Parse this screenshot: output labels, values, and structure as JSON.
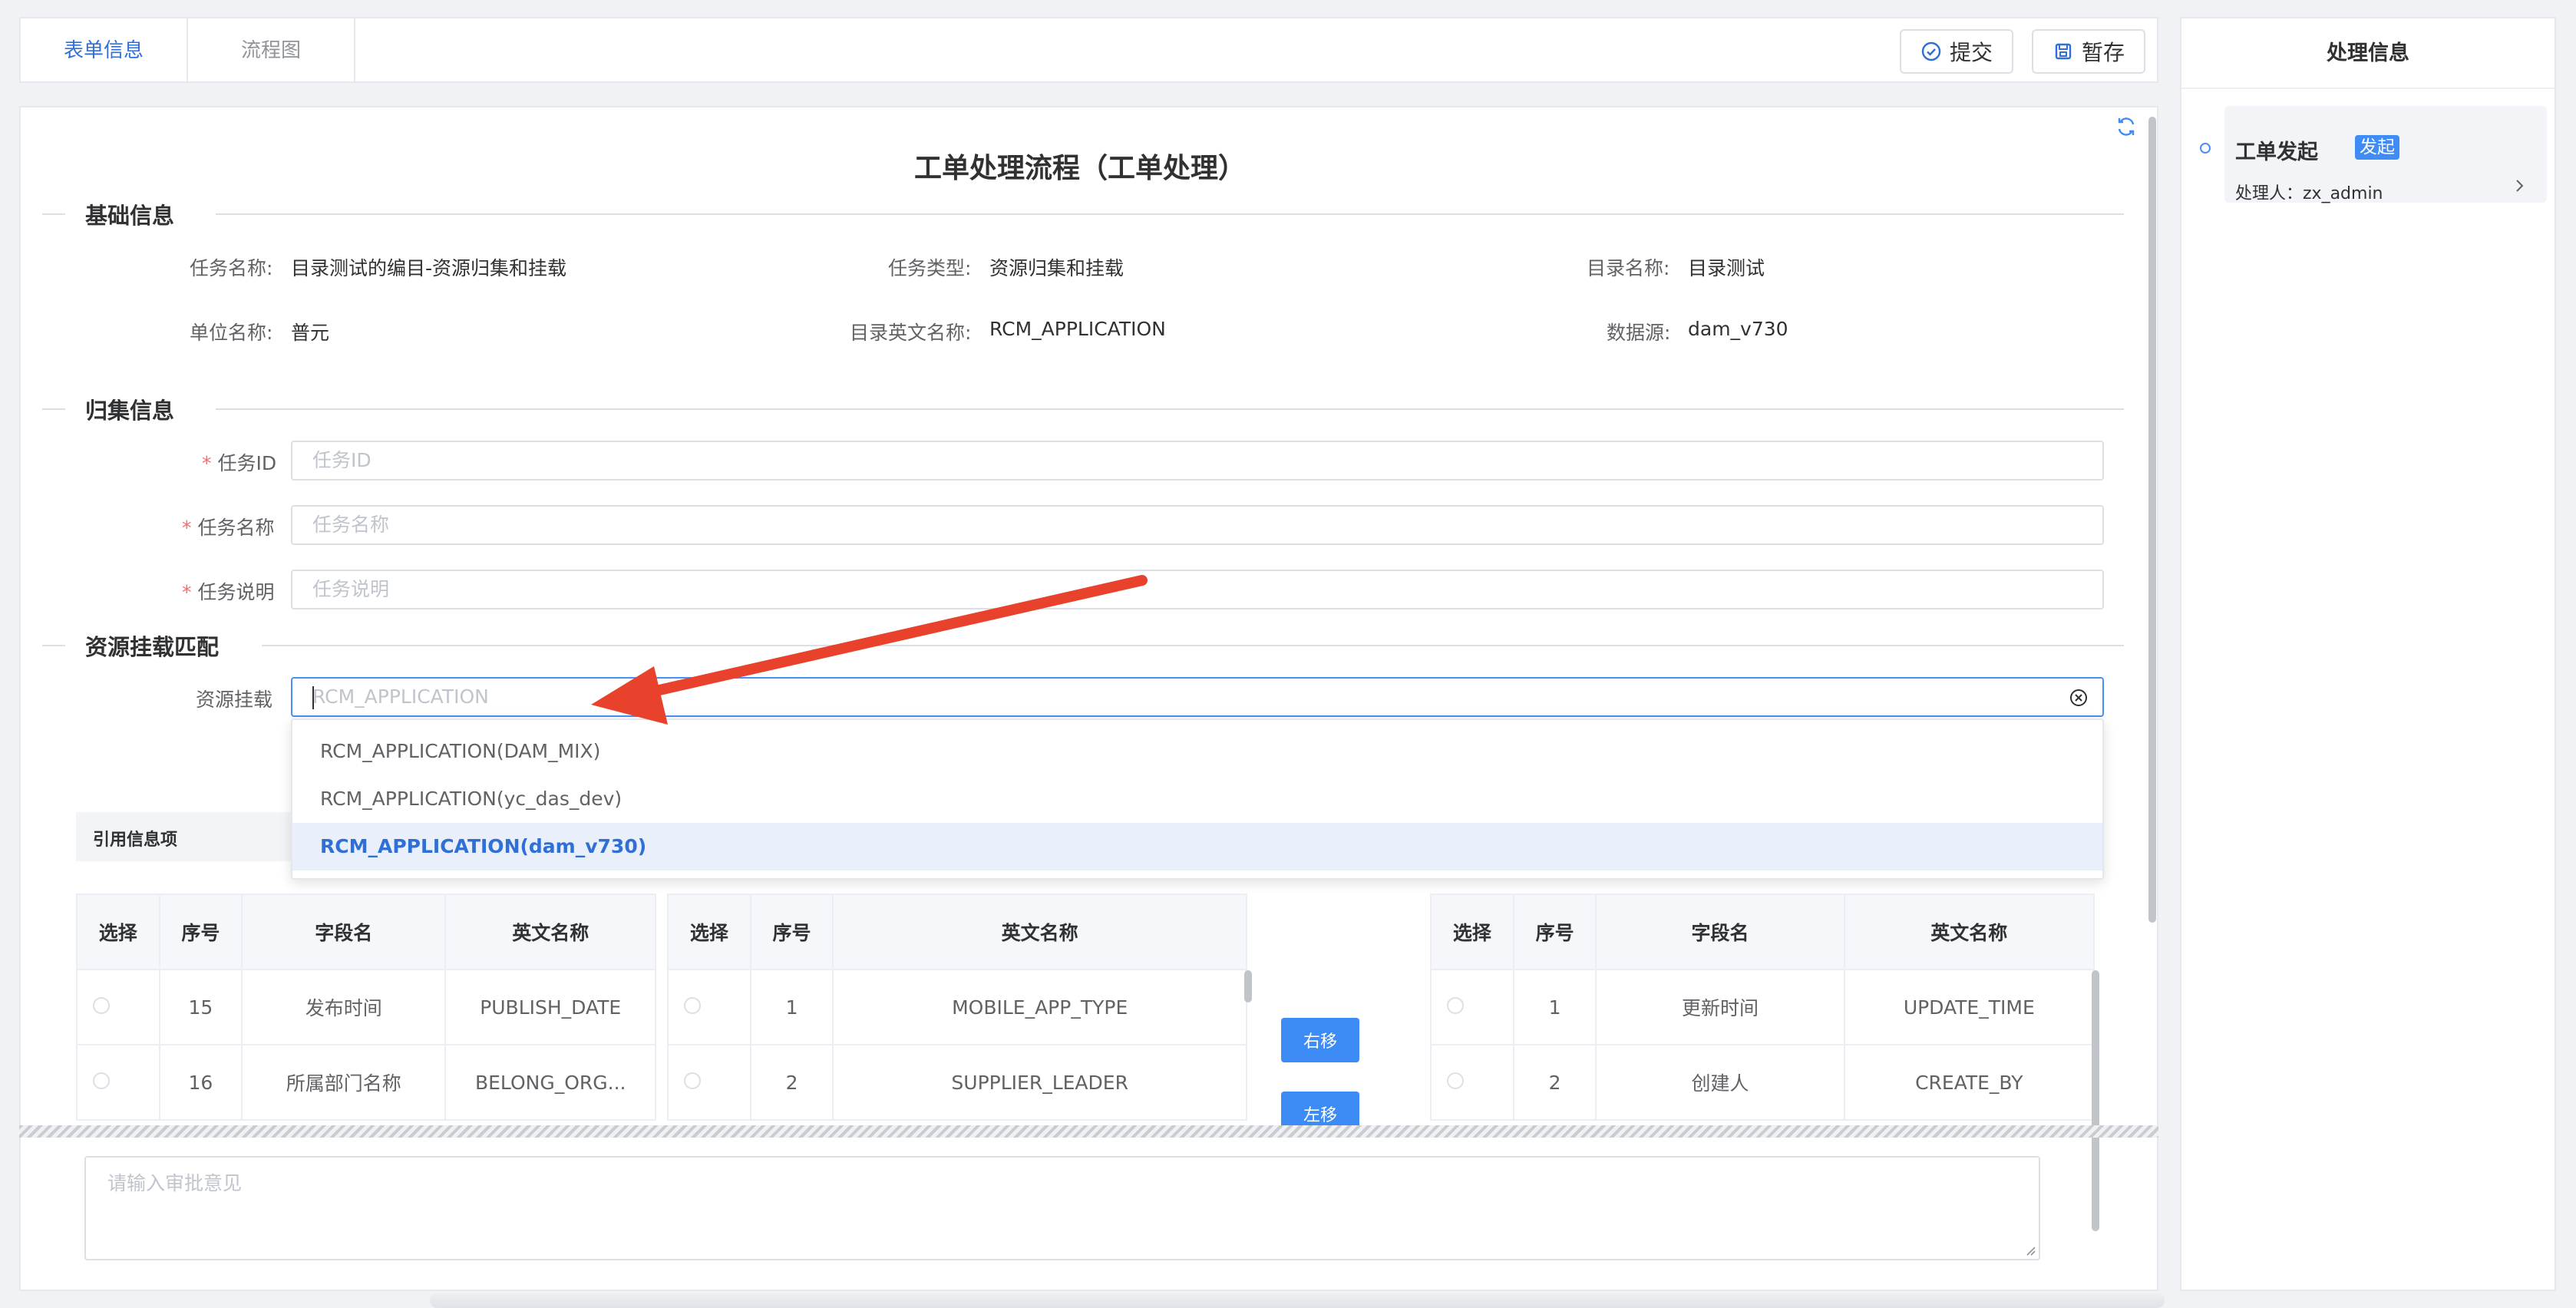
{
  "tabs": [
    {
      "label": "表单信息",
      "active": true
    },
    {
      "label": "流程图",
      "active": false
    }
  ],
  "toolbar": {
    "submit_label": "提交",
    "save_label": "暂存"
  },
  "right_panel": {
    "title": "处理信息",
    "timeline": [
      {
        "title": "工单发起",
        "badge": "发起",
        "handler": "处理人：zx_admin"
      }
    ]
  },
  "form": {
    "title": "工单处理流程（工单处理）",
    "sections": {
      "basic": "基础信息",
      "collect": "归集信息",
      "mount": "资源挂载匹配"
    },
    "basic": {
      "task_name_label": "任务名称:",
      "task_name": "目录测试的编目-资源归集和挂载",
      "task_type_label": "任务类型:",
      "task_type": "资源归集和挂载",
      "catalog_name_label": "目录名称:",
      "catalog_name": "目录测试",
      "unit_name_label": "单位名称:",
      "unit_name": "普元",
      "catalog_en_label": "目录英文名称:",
      "catalog_en": "RCM_APPLICATION",
      "datasource_label": "数据源:",
      "datasource": "dam_v730"
    },
    "collect": {
      "required_mark": "*",
      "task_id_label": "任务ID",
      "task_id_placeholder": "任务ID",
      "task_name_label": "任务名称",
      "task_name_placeholder": "任务名称",
      "task_desc_label": "任务说明",
      "task_desc_placeholder": "任务说明"
    },
    "mount": {
      "label": "资源挂载",
      "placeholder": "RCM_APPLICATION",
      "options": [
        "RCM_APPLICATION(DAM_MIX)",
        "RCM_APPLICATION(yc_das_dev)",
        "RCM_APPLICATION(dam_v730)"
      ],
      "selected_index": 2
    },
    "ref_label": "引用信息项"
  },
  "tables": {
    "left": {
      "headers": [
        "选择",
        "序号",
        "字段名",
        "英文名称"
      ],
      "rows": [
        [
          "15",
          "发布时间",
          "PUBLISH_DATE"
        ],
        [
          "16",
          "所属部门名称",
          "BELONG_ORG..."
        ]
      ]
    },
    "middle": {
      "headers": [
        "选择",
        "序号",
        "英文名称"
      ],
      "rows": [
        [
          "1",
          "MOBILE_APP_TYPE"
        ],
        [
          "2",
          "SUPPLIER_LEADER"
        ]
      ]
    },
    "right": {
      "headers": [
        "选择",
        "序号",
        "字段名",
        "英文名称"
      ],
      "rows": [
        [
          "1",
          "更新时间",
          "UPDATE_TIME"
        ],
        [
          "2",
          "创建人",
          "CREATE_BY"
        ]
      ]
    }
  },
  "move_buttons": {
    "right": "右移",
    "left": "左移"
  },
  "opinion_placeholder": "请输入审批意见",
  "colors": {
    "primary": "#3d8bf5",
    "arrow": "#e8412c",
    "required": "#f56c6c"
  }
}
